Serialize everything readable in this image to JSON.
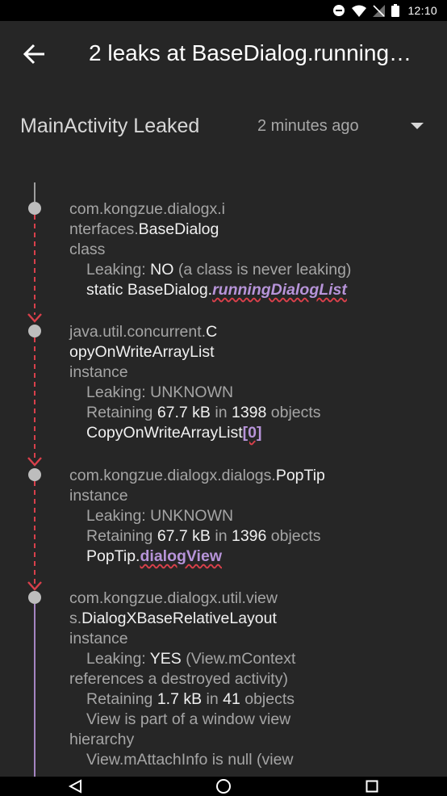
{
  "status_bar": {
    "time": "12:10"
  },
  "app_bar": {
    "title": "2 leaks at BaseDialog.runningDialogList"
  },
  "leak_header": {
    "title": "MainActivity Leaked",
    "time": "2 minutes ago"
  },
  "nodes": [
    {
      "class_prefix": "com.kongzue.dialogx.i",
      "class_prefix2": "nterfaces.",
      "class_name": "BaseDialog",
      "type": "class",
      "leaking_label": "Leaking: ",
      "leaking_value": "NO",
      "leaking_note": " (a class is never leaking)",
      "ref_prefix": "static BaseDialog.",
      "ref_name": "runningDialogList"
    },
    {
      "class_prefix": "java.util.concurrent.",
      "class_name_a": "C",
      "class_name_b": "opyOnWriteArrayList",
      "type": "instance",
      "leaking_label": "Leaking: UNKNOWN",
      "retaining_label": "Retaining ",
      "retaining_size": "67.7 kB",
      "retaining_in": " in ",
      "retaining_count": "1398",
      "retaining_suffix": " objects",
      "ref_prefix": "CopyOnWriteArrayList",
      "ref_name": "[0]"
    },
    {
      "class_prefix": "com.kongzue.dialogx.dialogs.",
      "class_name": "PopTip",
      "type": "instance",
      "leaking_label": "Leaking: UNKNOWN",
      "retaining_label": "Retaining ",
      "retaining_size": "67.7 kB",
      "retaining_in": " in ",
      "retaining_count": "1396",
      "retaining_suffix": " objects",
      "ref_prefix": "PopTip.",
      "ref_name": "dialogView"
    },
    {
      "class_prefix": "com.kongzue.dialogx.util.view",
      "class_prefix2": "s.",
      "class_name": "DialogXBaseRelativeLayout",
      "type": "instance",
      "leaking_label": "Leaking: ",
      "leaking_value": "YES",
      "leaking_note": " (View.mContext",
      "leaking_note2": "references a destroyed activity)",
      "retaining_label": "Retaining ",
      "retaining_size": "1.7 kB",
      "retaining_in": " in ",
      "retaining_count": "41",
      "retaining_suffix": " objects",
      "detail1": "View is part of a window view",
      "detail1b": "hierarchy",
      "detail2": "View.mAttachInfo is null (view"
    }
  ],
  "icons": {
    "back": "arrow-back-icon",
    "dropdown": "dropdown-arrow-icon",
    "nav_back": "nav-back-icon",
    "nav_home": "nav-home-icon",
    "nav_recents": "nav-recents-icon"
  },
  "colors": {
    "background": "#262626",
    "reference": "#b794d9",
    "leak_trace": "#d9404b",
    "leaking_trace": "#a585c2"
  }
}
